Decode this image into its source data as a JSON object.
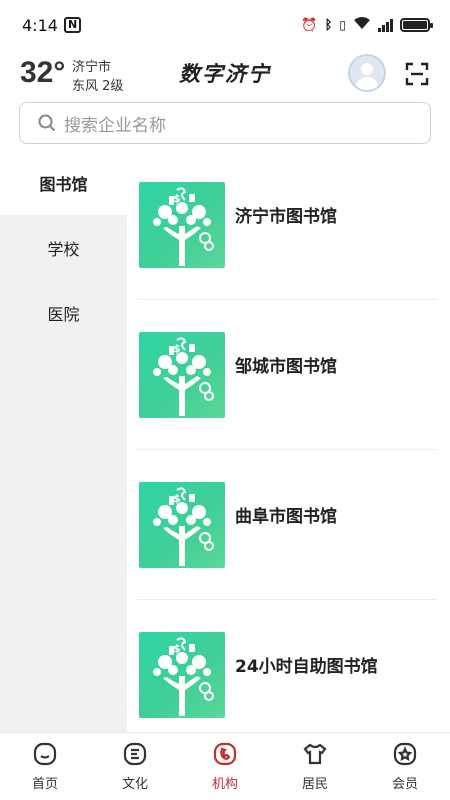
{
  "status_bar": {
    "time": "4:14",
    "nfc_label": "N"
  },
  "header": {
    "temperature": "32°",
    "city": "济宁市",
    "wind": "东风  2级",
    "app_title": "数字济宁"
  },
  "search": {
    "placeholder": "搜索企业名称"
  },
  "sidebar": {
    "items": [
      {
        "label": "图书馆",
        "active": true
      },
      {
        "label": "学校",
        "active": false
      },
      {
        "label": "医院",
        "active": false
      }
    ]
  },
  "list": {
    "items": [
      {
        "name": "济宁市图书馆"
      },
      {
        "name": "邹城市图书馆"
      },
      {
        "name": "曲阜市图书馆"
      },
      {
        "name": "24小时自助图书馆"
      }
    ]
  },
  "bottom_nav": {
    "items": [
      {
        "label": "首页",
        "icon": "home-icon"
      },
      {
        "label": "文化",
        "icon": "culture-icon"
      },
      {
        "label": "机构",
        "icon": "institution-icon"
      },
      {
        "label": "居民",
        "icon": "resident-icon"
      },
      {
        "label": "会员",
        "icon": "member-icon"
      }
    ],
    "active_index": 2
  },
  "colors": {
    "accent": "#c0302f",
    "thumb_green": "#3fcf95",
    "sidebar_bg": "#f1f1f1"
  }
}
